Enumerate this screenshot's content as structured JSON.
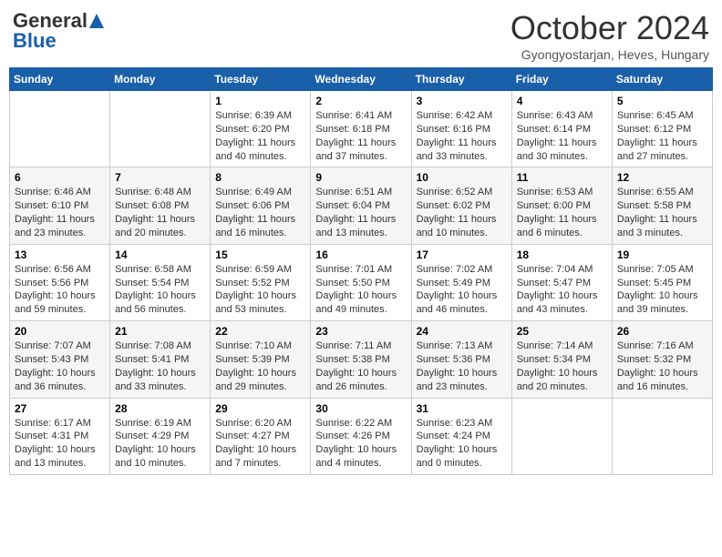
{
  "header": {
    "logo_general": "General",
    "logo_blue": "Blue",
    "month_title": "October 2024",
    "location": "Gyongyostarjan, Heves, Hungary"
  },
  "weekdays": [
    "Sunday",
    "Monday",
    "Tuesday",
    "Wednesday",
    "Thursday",
    "Friday",
    "Saturday"
  ],
  "weeks": [
    [
      {
        "day": "",
        "info": ""
      },
      {
        "day": "",
        "info": ""
      },
      {
        "day": "1",
        "info": "Sunrise: 6:39 AM\nSunset: 6:20 PM\nDaylight: 11 hours and 40 minutes."
      },
      {
        "day": "2",
        "info": "Sunrise: 6:41 AM\nSunset: 6:18 PM\nDaylight: 11 hours and 37 minutes."
      },
      {
        "day": "3",
        "info": "Sunrise: 6:42 AM\nSunset: 6:16 PM\nDaylight: 11 hours and 33 minutes."
      },
      {
        "day": "4",
        "info": "Sunrise: 6:43 AM\nSunset: 6:14 PM\nDaylight: 11 hours and 30 minutes."
      },
      {
        "day": "5",
        "info": "Sunrise: 6:45 AM\nSunset: 6:12 PM\nDaylight: 11 hours and 27 minutes."
      }
    ],
    [
      {
        "day": "6",
        "info": "Sunrise: 6:46 AM\nSunset: 6:10 PM\nDaylight: 11 hours and 23 minutes."
      },
      {
        "day": "7",
        "info": "Sunrise: 6:48 AM\nSunset: 6:08 PM\nDaylight: 11 hours and 20 minutes."
      },
      {
        "day": "8",
        "info": "Sunrise: 6:49 AM\nSunset: 6:06 PM\nDaylight: 11 hours and 16 minutes."
      },
      {
        "day": "9",
        "info": "Sunrise: 6:51 AM\nSunset: 6:04 PM\nDaylight: 11 hours and 13 minutes."
      },
      {
        "day": "10",
        "info": "Sunrise: 6:52 AM\nSunset: 6:02 PM\nDaylight: 11 hours and 10 minutes."
      },
      {
        "day": "11",
        "info": "Sunrise: 6:53 AM\nSunset: 6:00 PM\nDaylight: 11 hours and 6 minutes."
      },
      {
        "day": "12",
        "info": "Sunrise: 6:55 AM\nSunset: 5:58 PM\nDaylight: 11 hours and 3 minutes."
      }
    ],
    [
      {
        "day": "13",
        "info": "Sunrise: 6:56 AM\nSunset: 5:56 PM\nDaylight: 10 hours and 59 minutes."
      },
      {
        "day": "14",
        "info": "Sunrise: 6:58 AM\nSunset: 5:54 PM\nDaylight: 10 hours and 56 minutes."
      },
      {
        "day": "15",
        "info": "Sunrise: 6:59 AM\nSunset: 5:52 PM\nDaylight: 10 hours and 53 minutes."
      },
      {
        "day": "16",
        "info": "Sunrise: 7:01 AM\nSunset: 5:50 PM\nDaylight: 10 hours and 49 minutes."
      },
      {
        "day": "17",
        "info": "Sunrise: 7:02 AM\nSunset: 5:49 PM\nDaylight: 10 hours and 46 minutes."
      },
      {
        "day": "18",
        "info": "Sunrise: 7:04 AM\nSunset: 5:47 PM\nDaylight: 10 hours and 43 minutes."
      },
      {
        "day": "19",
        "info": "Sunrise: 7:05 AM\nSunset: 5:45 PM\nDaylight: 10 hours and 39 minutes."
      }
    ],
    [
      {
        "day": "20",
        "info": "Sunrise: 7:07 AM\nSunset: 5:43 PM\nDaylight: 10 hours and 36 minutes."
      },
      {
        "day": "21",
        "info": "Sunrise: 7:08 AM\nSunset: 5:41 PM\nDaylight: 10 hours and 33 minutes."
      },
      {
        "day": "22",
        "info": "Sunrise: 7:10 AM\nSunset: 5:39 PM\nDaylight: 10 hours and 29 minutes."
      },
      {
        "day": "23",
        "info": "Sunrise: 7:11 AM\nSunset: 5:38 PM\nDaylight: 10 hours and 26 minutes."
      },
      {
        "day": "24",
        "info": "Sunrise: 7:13 AM\nSunset: 5:36 PM\nDaylight: 10 hours and 23 minutes."
      },
      {
        "day": "25",
        "info": "Sunrise: 7:14 AM\nSunset: 5:34 PM\nDaylight: 10 hours and 20 minutes."
      },
      {
        "day": "26",
        "info": "Sunrise: 7:16 AM\nSunset: 5:32 PM\nDaylight: 10 hours and 16 minutes."
      }
    ],
    [
      {
        "day": "27",
        "info": "Sunrise: 6:17 AM\nSunset: 4:31 PM\nDaylight: 10 hours and 13 minutes."
      },
      {
        "day": "28",
        "info": "Sunrise: 6:19 AM\nSunset: 4:29 PM\nDaylight: 10 hours and 10 minutes."
      },
      {
        "day": "29",
        "info": "Sunrise: 6:20 AM\nSunset: 4:27 PM\nDaylight: 10 hours and 7 minutes."
      },
      {
        "day": "30",
        "info": "Sunrise: 6:22 AM\nSunset: 4:26 PM\nDaylight: 10 hours and 4 minutes."
      },
      {
        "day": "31",
        "info": "Sunrise: 6:23 AM\nSunset: 4:24 PM\nDaylight: 10 hours and 0 minutes."
      },
      {
        "day": "",
        "info": ""
      },
      {
        "day": "",
        "info": ""
      }
    ]
  ]
}
